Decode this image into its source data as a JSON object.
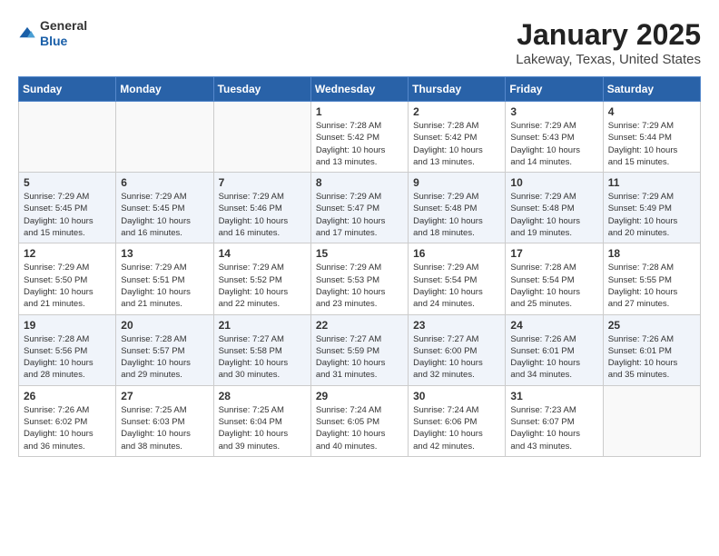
{
  "header": {
    "logo_general": "General",
    "logo_blue": "Blue",
    "month": "January 2025",
    "location": "Lakeway, Texas, United States"
  },
  "weekdays": [
    "Sunday",
    "Monday",
    "Tuesday",
    "Wednesday",
    "Thursday",
    "Friday",
    "Saturday"
  ],
  "weeks": [
    [
      {
        "day": "",
        "info": ""
      },
      {
        "day": "",
        "info": ""
      },
      {
        "day": "",
        "info": ""
      },
      {
        "day": "1",
        "info": "Sunrise: 7:28 AM\nSunset: 5:42 PM\nDaylight: 10 hours\nand 13 minutes."
      },
      {
        "day": "2",
        "info": "Sunrise: 7:28 AM\nSunset: 5:42 PM\nDaylight: 10 hours\nand 13 minutes."
      },
      {
        "day": "3",
        "info": "Sunrise: 7:29 AM\nSunset: 5:43 PM\nDaylight: 10 hours\nand 14 minutes."
      },
      {
        "day": "4",
        "info": "Sunrise: 7:29 AM\nSunset: 5:44 PM\nDaylight: 10 hours\nand 15 minutes."
      }
    ],
    [
      {
        "day": "5",
        "info": "Sunrise: 7:29 AM\nSunset: 5:45 PM\nDaylight: 10 hours\nand 15 minutes."
      },
      {
        "day": "6",
        "info": "Sunrise: 7:29 AM\nSunset: 5:45 PM\nDaylight: 10 hours\nand 16 minutes."
      },
      {
        "day": "7",
        "info": "Sunrise: 7:29 AM\nSunset: 5:46 PM\nDaylight: 10 hours\nand 16 minutes."
      },
      {
        "day": "8",
        "info": "Sunrise: 7:29 AM\nSunset: 5:47 PM\nDaylight: 10 hours\nand 17 minutes."
      },
      {
        "day": "9",
        "info": "Sunrise: 7:29 AM\nSunset: 5:48 PM\nDaylight: 10 hours\nand 18 minutes."
      },
      {
        "day": "10",
        "info": "Sunrise: 7:29 AM\nSunset: 5:48 PM\nDaylight: 10 hours\nand 19 minutes."
      },
      {
        "day": "11",
        "info": "Sunrise: 7:29 AM\nSunset: 5:49 PM\nDaylight: 10 hours\nand 20 minutes."
      }
    ],
    [
      {
        "day": "12",
        "info": "Sunrise: 7:29 AM\nSunset: 5:50 PM\nDaylight: 10 hours\nand 21 minutes."
      },
      {
        "day": "13",
        "info": "Sunrise: 7:29 AM\nSunset: 5:51 PM\nDaylight: 10 hours\nand 21 minutes."
      },
      {
        "day": "14",
        "info": "Sunrise: 7:29 AM\nSunset: 5:52 PM\nDaylight: 10 hours\nand 22 minutes."
      },
      {
        "day": "15",
        "info": "Sunrise: 7:29 AM\nSunset: 5:53 PM\nDaylight: 10 hours\nand 23 minutes."
      },
      {
        "day": "16",
        "info": "Sunrise: 7:29 AM\nSunset: 5:54 PM\nDaylight: 10 hours\nand 24 minutes."
      },
      {
        "day": "17",
        "info": "Sunrise: 7:28 AM\nSunset: 5:54 PM\nDaylight: 10 hours\nand 25 minutes."
      },
      {
        "day": "18",
        "info": "Sunrise: 7:28 AM\nSunset: 5:55 PM\nDaylight: 10 hours\nand 27 minutes."
      }
    ],
    [
      {
        "day": "19",
        "info": "Sunrise: 7:28 AM\nSunset: 5:56 PM\nDaylight: 10 hours\nand 28 minutes."
      },
      {
        "day": "20",
        "info": "Sunrise: 7:28 AM\nSunset: 5:57 PM\nDaylight: 10 hours\nand 29 minutes."
      },
      {
        "day": "21",
        "info": "Sunrise: 7:27 AM\nSunset: 5:58 PM\nDaylight: 10 hours\nand 30 minutes."
      },
      {
        "day": "22",
        "info": "Sunrise: 7:27 AM\nSunset: 5:59 PM\nDaylight: 10 hours\nand 31 minutes."
      },
      {
        "day": "23",
        "info": "Sunrise: 7:27 AM\nSunset: 6:00 PM\nDaylight: 10 hours\nand 32 minutes."
      },
      {
        "day": "24",
        "info": "Sunrise: 7:26 AM\nSunset: 6:01 PM\nDaylight: 10 hours\nand 34 minutes."
      },
      {
        "day": "25",
        "info": "Sunrise: 7:26 AM\nSunset: 6:01 PM\nDaylight: 10 hours\nand 35 minutes."
      }
    ],
    [
      {
        "day": "26",
        "info": "Sunrise: 7:26 AM\nSunset: 6:02 PM\nDaylight: 10 hours\nand 36 minutes."
      },
      {
        "day": "27",
        "info": "Sunrise: 7:25 AM\nSunset: 6:03 PM\nDaylight: 10 hours\nand 38 minutes."
      },
      {
        "day": "28",
        "info": "Sunrise: 7:25 AM\nSunset: 6:04 PM\nDaylight: 10 hours\nand 39 minutes."
      },
      {
        "day": "29",
        "info": "Sunrise: 7:24 AM\nSunset: 6:05 PM\nDaylight: 10 hours\nand 40 minutes."
      },
      {
        "day": "30",
        "info": "Sunrise: 7:24 AM\nSunset: 6:06 PM\nDaylight: 10 hours\nand 42 minutes."
      },
      {
        "day": "31",
        "info": "Sunrise: 7:23 AM\nSunset: 6:07 PM\nDaylight: 10 hours\nand 43 minutes."
      },
      {
        "day": "",
        "info": ""
      }
    ]
  ]
}
